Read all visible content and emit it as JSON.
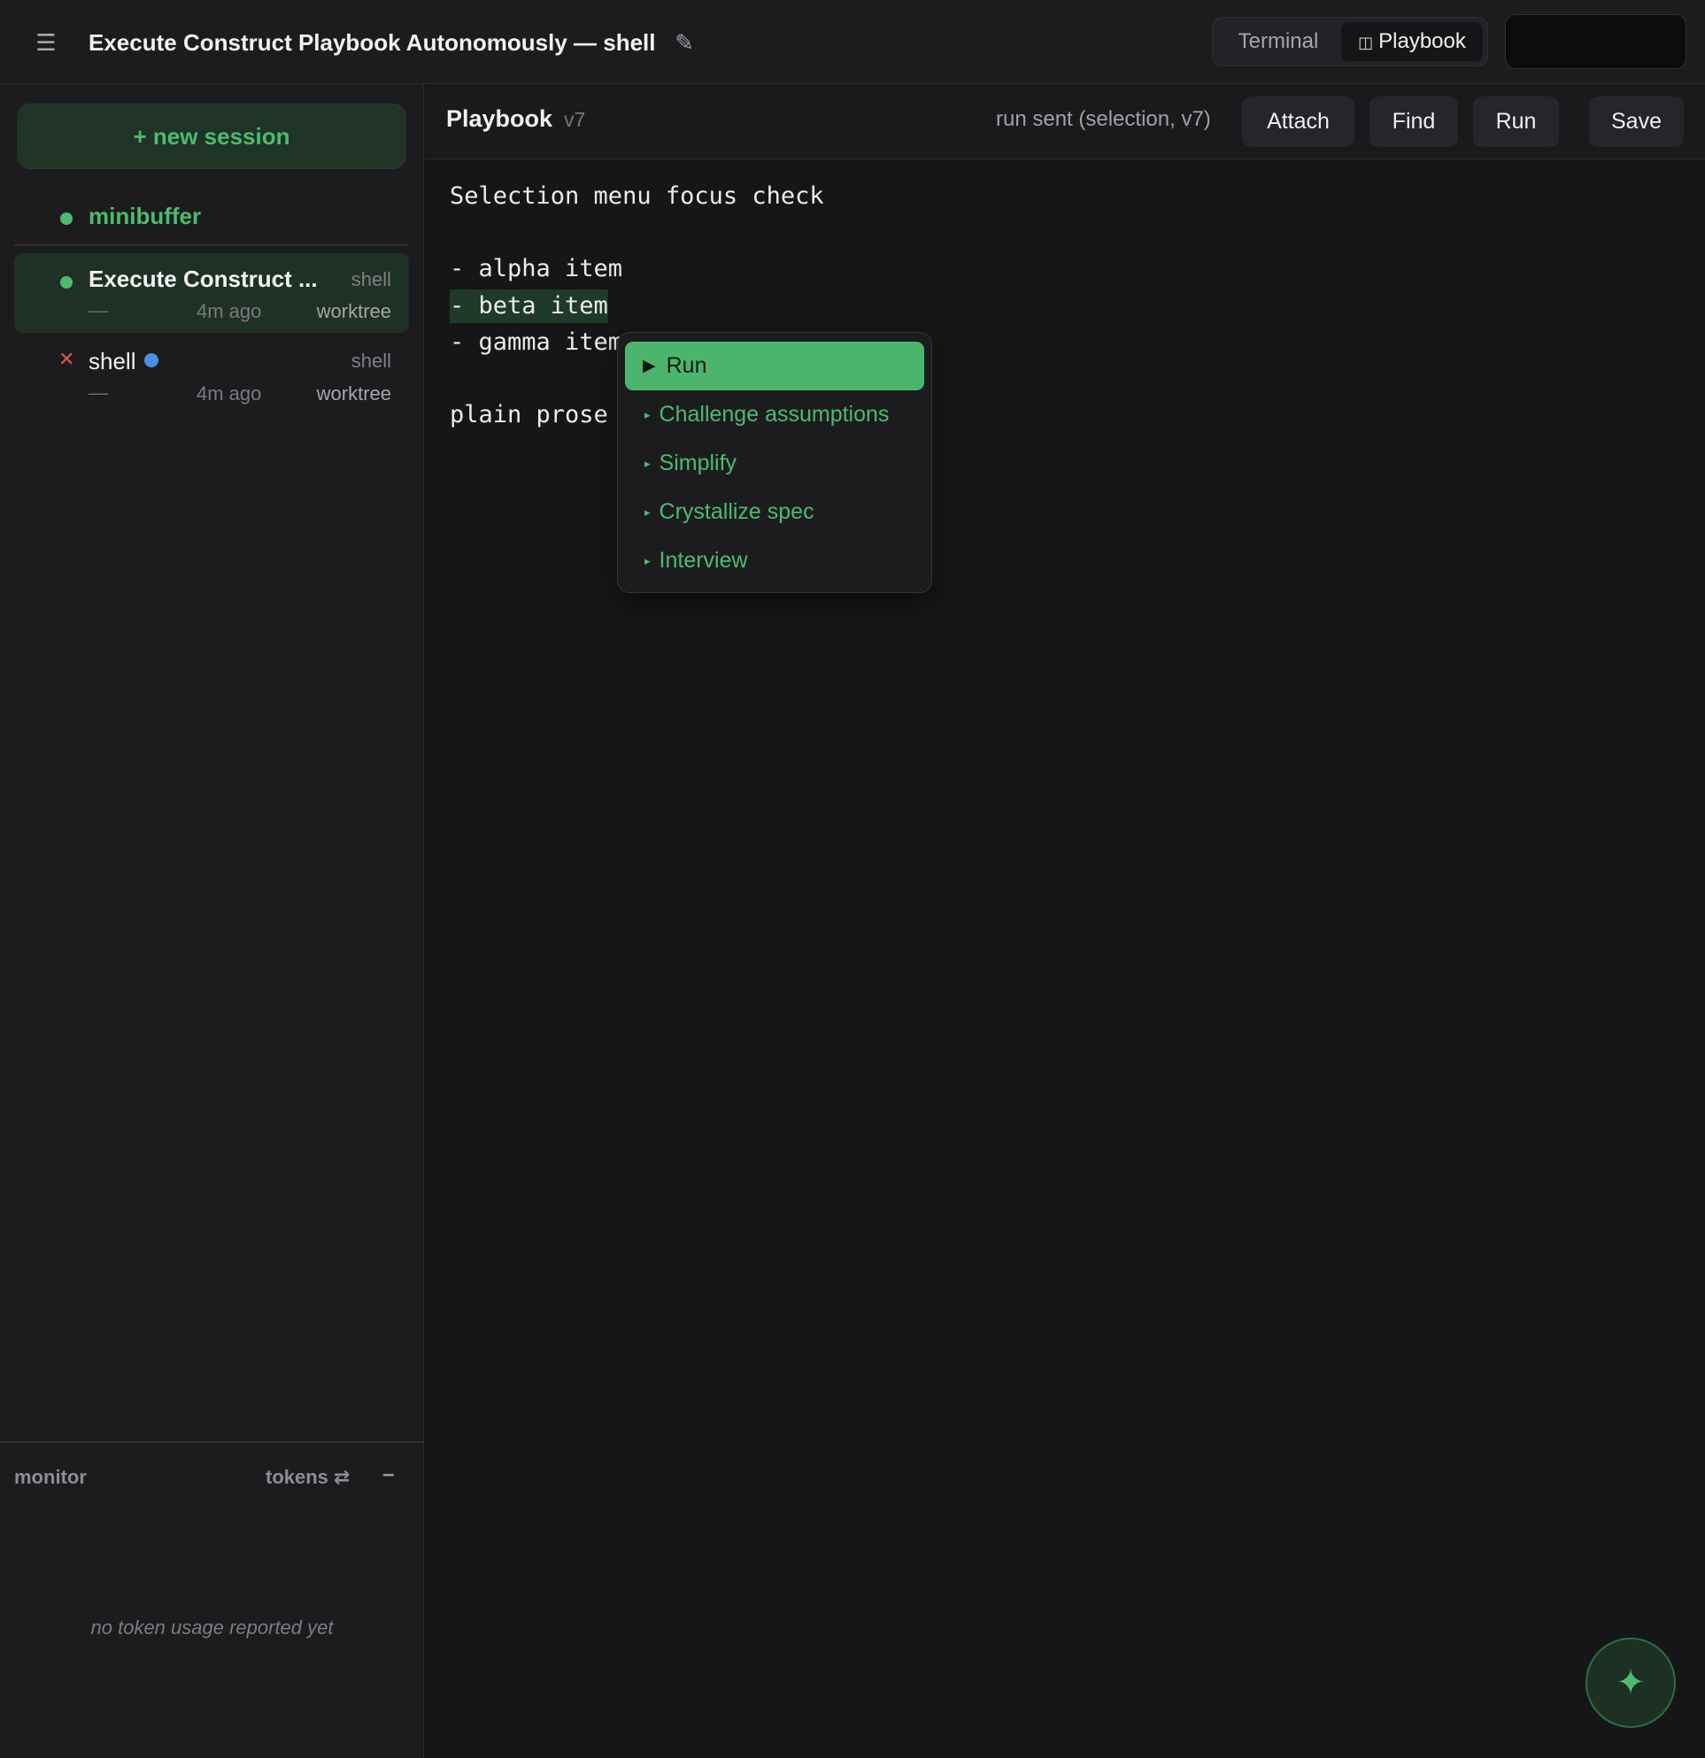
{
  "topbar": {
    "menu_icon": "☰",
    "title": "Execute Construct Playbook Autonomously — shell",
    "edit_icon": "✎",
    "view_tabs": [
      {
        "label": "Terminal",
        "active": false
      },
      {
        "icon": "◫",
        "label": "Playbook",
        "active": true
      }
    ]
  },
  "sidebar": {
    "new_session_label": "+ new session",
    "sessions": [
      {
        "title": "minibuffer",
        "status": "green"
      },
      {
        "title": "Execute Construct ...",
        "kind": "shell",
        "dash": "—",
        "time": "4m ago",
        "tree": "worktree",
        "status": "green",
        "active": true
      },
      {
        "title": "shell",
        "kind": "shell",
        "dash": "—",
        "time": "4m ago",
        "tree": "worktree",
        "status": "error",
        "badge": "blue-dot",
        "close_icon": "✕"
      }
    ],
    "monitor": {
      "label": "monitor",
      "tokens_label": "tokens ⇄",
      "collapse_label": "–",
      "empty_text": "no token usage reported yet"
    }
  },
  "editor": {
    "title": "Playbook",
    "version": "v7",
    "status": "run sent (selection, v7)",
    "buttons": {
      "attach": "Attach",
      "find": "Find",
      "run": "Run",
      "save": "Save"
    },
    "lines": [
      "Selection menu focus check",
      "- alpha item",
      "- beta item",
      "- gamma item",
      "plain prose"
    ],
    "selected_line": "- beta item"
  },
  "context_menu": {
    "items": [
      {
        "icon": "▶",
        "label": "Run",
        "primary": true
      },
      {
        "icon": "▸",
        "label": "Challenge assumptions"
      },
      {
        "icon": "▸",
        "label": "Simplify"
      },
      {
        "icon": "▸",
        "label": "Crystallize spec"
      },
      {
        "icon": "▸",
        "label": "Interview"
      }
    ]
  },
  "fab": {
    "icon": "✦"
  },
  "colors": {
    "accent": "#4cbb71",
    "background": "#161618",
    "panel": "#1c1c1f",
    "selection": "#1f3a28",
    "error": "#e0554d",
    "info": "#4a90e2"
  }
}
